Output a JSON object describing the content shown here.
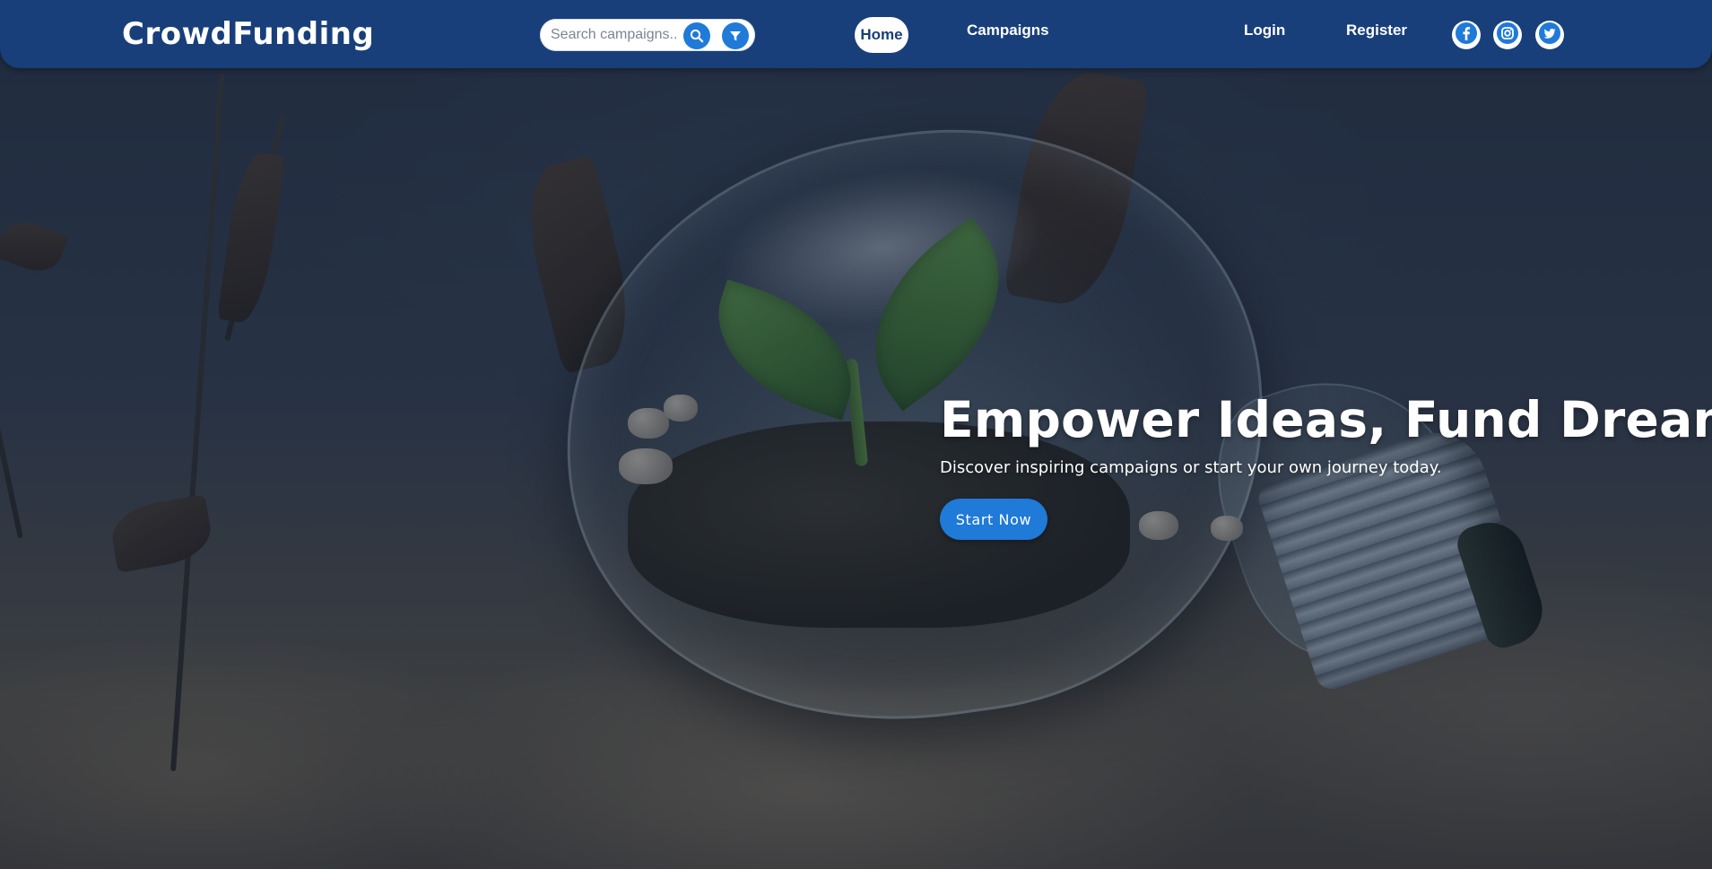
{
  "navbar": {
    "brand": "CrowdFunding",
    "search": {
      "placeholder": "Search campaigns...",
      "search_icon": "search-icon",
      "filter_icon": "filter-icon"
    },
    "links": {
      "home": "Home",
      "campaigns": "Campaigns",
      "login": "Login",
      "register": "Register"
    },
    "active_link": "Home",
    "social": [
      "facebook-icon",
      "instagram-icon",
      "twitter-icon"
    ]
  },
  "hero": {
    "title": "Empower Ideas, Fund Dreams",
    "subtitle": "Discover inspiring campaigns or start your own journey today.",
    "cta_label": "Start Now"
  },
  "colors": {
    "navbar_bg": "#183f7a",
    "accent": "#1f7ad8",
    "text_light": "#ffffff"
  }
}
